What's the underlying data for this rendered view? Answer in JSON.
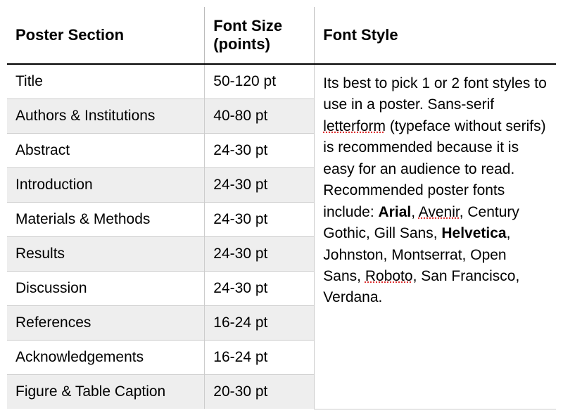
{
  "headers": {
    "section": "Poster Section",
    "size": "Font Size (points)",
    "style": "Font Style"
  },
  "rows": [
    {
      "section": "Title",
      "size": "50-120 pt"
    },
    {
      "section": "Authors & Institutions",
      "size": "40-80 pt"
    },
    {
      "section": "Abstract",
      "size": "24-30 pt"
    },
    {
      "section": "Introduction",
      "size": "24-30 pt"
    },
    {
      "section": "Materials & Methods",
      "size": "24-30 pt"
    },
    {
      "section": "Results",
      "size": "24-30 pt"
    },
    {
      "section": "Discussion",
      "size": "24-30 pt"
    },
    {
      "section": "References",
      "size": "16-24 pt"
    },
    {
      "section": "Acknowledgements",
      "size": "16-24 pt"
    },
    {
      "section": "Figure & Table Caption",
      "size": "20-30 pt"
    }
  ],
  "style_text": {
    "p1a": "Its best to pick 1 or 2 font styles to use in a poster.  Sans-serif ",
    "p1b": "letterform",
    "p1c": " (typeface without serifs) is recommended because it is easy for an audience to read.  Recommended poster fonts include:  ",
    "f_arial": "Arial",
    "s1": ", ",
    "f_avenir": "Avenir",
    "s2": ", Century Gothic, Gill Sans, ",
    "f_helv": "Helvetica",
    "s3": ", Johnston, Montserrat, Open Sans, ",
    "f_roboto": "Roboto",
    "s4": ", San Francisco, Verdana."
  }
}
